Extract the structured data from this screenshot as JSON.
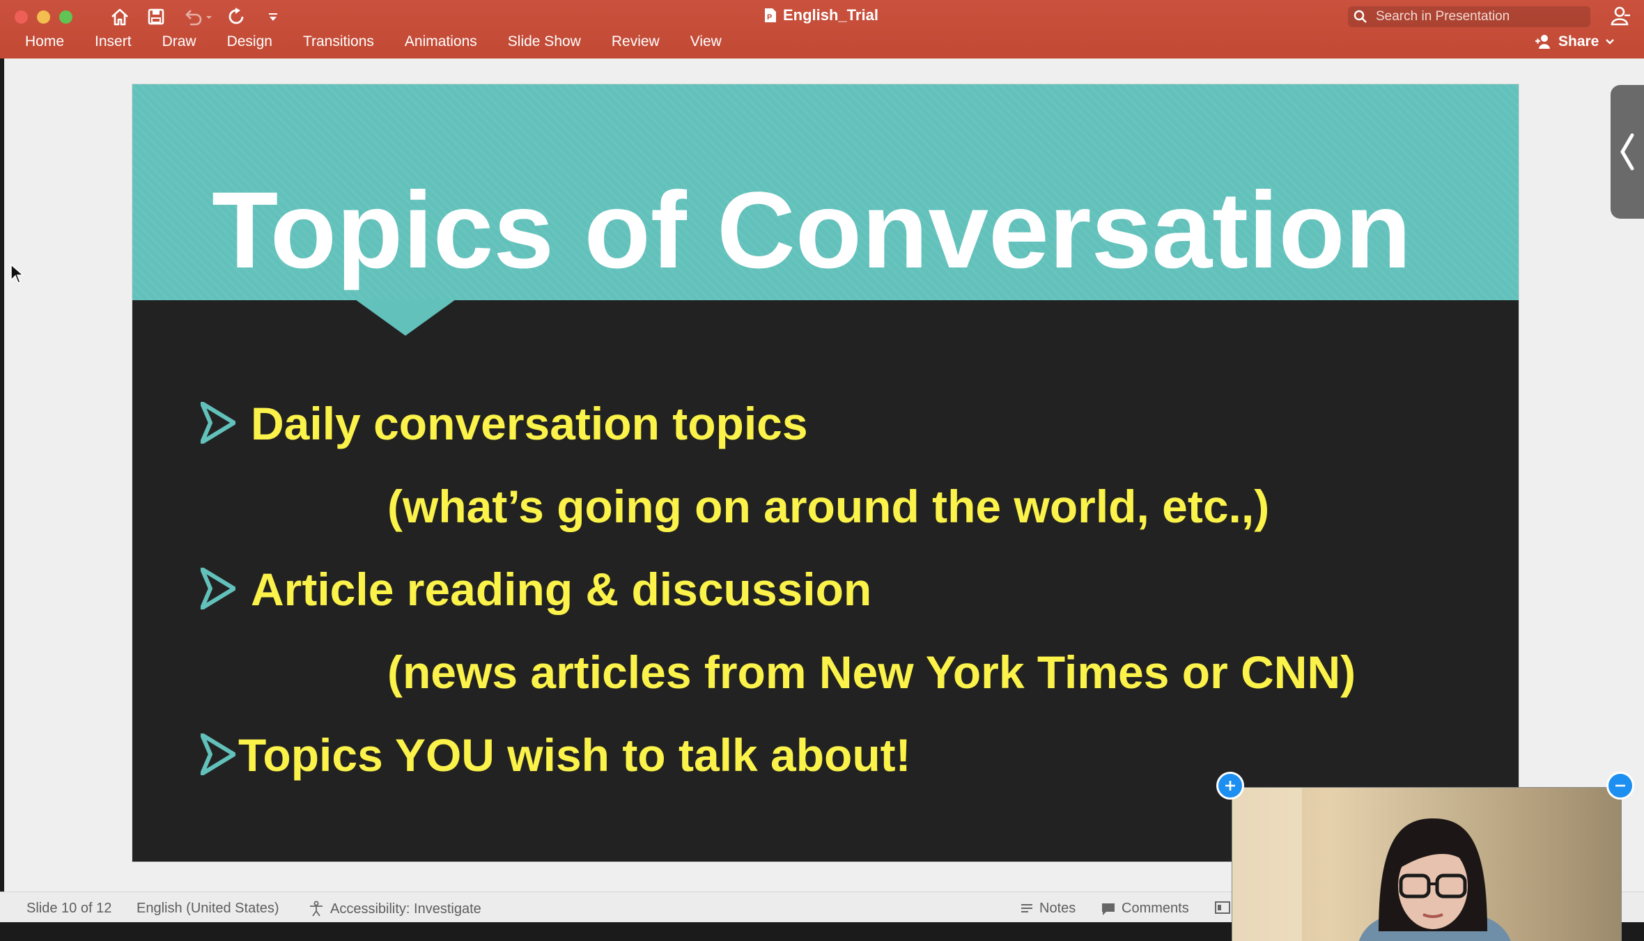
{
  "window": {
    "title": "English_Trial",
    "search_placeholder": "Search in Presentation",
    "share_label": "Share"
  },
  "ribbon": {
    "tabs": [
      "Home",
      "Insert",
      "Draw",
      "Design",
      "Transitions",
      "Animations",
      "Slide Show",
      "Review",
      "View"
    ]
  },
  "slide": {
    "title": "Topics of Conversation",
    "bullets": [
      {
        "text": "Daily conversation topics",
        "sub": "(what’s going on around the world, etc.,)"
      },
      {
        "text": "Article reading & discussion",
        "sub": "(news articles from New York Times or CNN)"
      },
      {
        "text": "Topics YOU wish to talk about!",
        "sub": ""
      }
    ],
    "colors": {
      "header": "#62c1bb",
      "body": "#222222",
      "title": "#ffffff",
      "text": "#fbf24a",
      "arrow": "#62c1bb"
    }
  },
  "status": {
    "slide_indicator": "Slide 10 of 12",
    "language": "English (United States)",
    "accessibility": "Accessibility: Investigate",
    "notes": "Notes",
    "comments": "Comments"
  },
  "icons": {
    "home": "home-icon",
    "save": "save-icon",
    "undo": "undo-icon",
    "redo": "redo-icon",
    "customize": "customize-toolbar-icon",
    "search": "search-icon",
    "account": "account-icon",
    "panel": "panel-toggle-icon"
  }
}
